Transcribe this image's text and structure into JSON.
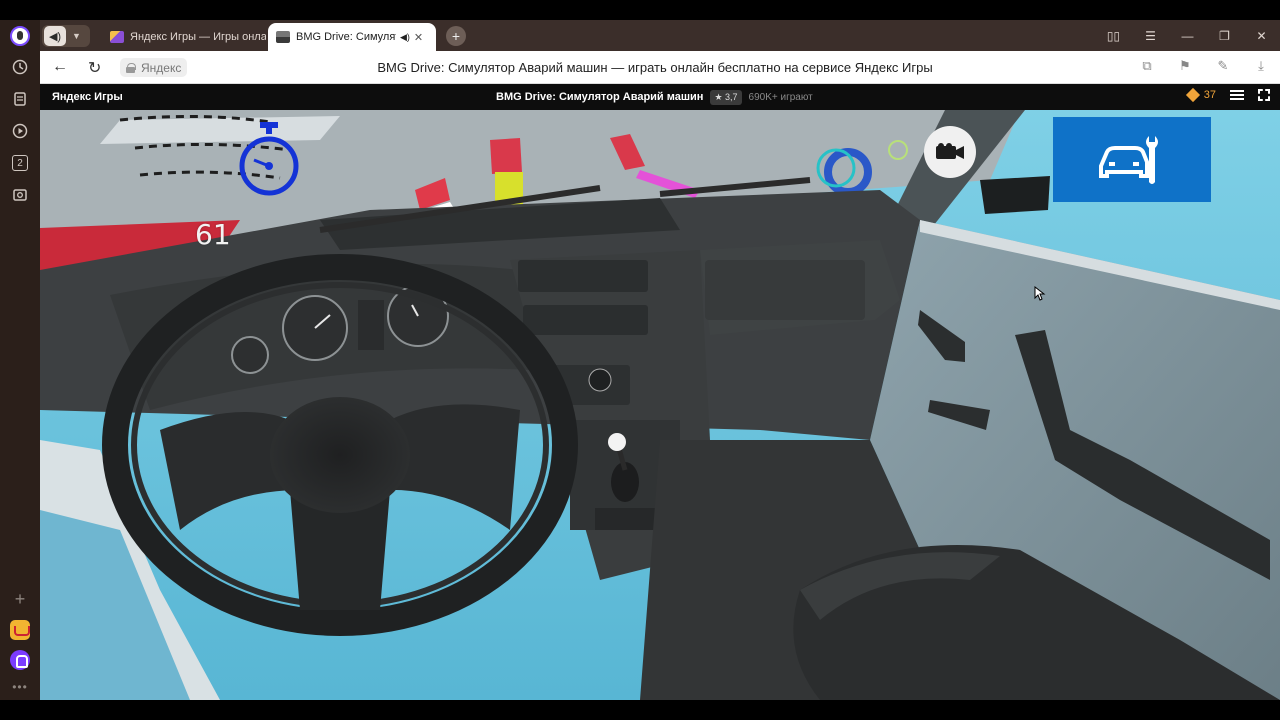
{
  "browser": {
    "tabs": [
      {
        "title": "Яндекс Игры — Игры онлайн",
        "active": false
      },
      {
        "title": "BMG Drive: Симулятор Аварий машин",
        "active": true
      }
    ],
    "new_tab_label": "+",
    "address": {
      "domain": "Яндекс",
      "page_title": "BMG Drive: Симулятор Аварий машин — играть онлайн бесплатно на сервисе Яндекс Игры"
    },
    "sidebar_badge": "2"
  },
  "yandex_games": {
    "brand": "Яндекс Игры",
    "game_title": "BMG Drive: Симулятор Аварий машин",
    "rating": "★ 3,7",
    "players": "690K+ играют",
    "coins": "37"
  },
  "game": {
    "speed": "61",
    "icons": [
      "stopwatch-icon",
      "camera-icon",
      "car-repair-icon"
    ],
    "colors": {
      "sky": "#6cc4de",
      "dashboard": "#3a3c3d",
      "repair_button": "#0f72c8",
      "stopwatch": "#1433d6"
    }
  }
}
